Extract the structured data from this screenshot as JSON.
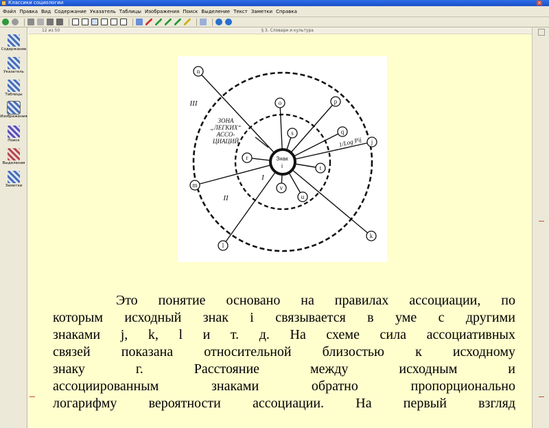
{
  "window": {
    "title": "Классики социологии"
  },
  "menu": [
    "Файл",
    "Правка",
    "Вид",
    "Содержание",
    "Указатель",
    "Таблицы",
    "Изображения",
    "Поиск",
    "Выделение",
    "Текст",
    "Заметки",
    "Справка"
  ],
  "sidebar": {
    "items": [
      {
        "label": "Содержание",
        "color": "#4a6fb5"
      },
      {
        "label": "Указатель",
        "color": "#4a6fb5"
      },
      {
        "label": "Таблицы",
        "color": "#4a6fb5"
      },
      {
        "label": "Изображения",
        "color": "#4a6fb5",
        "active": true
      },
      {
        "label": "Поиск",
        "color": "#5a4fb5"
      },
      {
        "label": "Выделения",
        "color": "#b54a4a"
      },
      {
        "label": "Заметки",
        "color": "#4a6fb5"
      }
    ]
  },
  "page": {
    "number": "12 из 50",
    "title": "§ 3. Словари и культура"
  },
  "figure": {
    "zone_label_lines": [
      "ЗОНА",
      "„ЛЕГКИХ“",
      "АССО-",
      "ЦИАЦИЙ"
    ],
    "center_line1": "Знак",
    "center_line2": "i",
    "roman_I": "I",
    "roman_II": "II",
    "roman_III": "III",
    "log_label": "1/Log Pij",
    "nodes": {
      "n": "n",
      "o": "o",
      "p": "p",
      "s": "s",
      "q": "q",
      "j": "j",
      "r": "r",
      "t": "t",
      "v": "v",
      "u": "u",
      "m": "m",
      "l": "l",
      "k": "k"
    }
  },
  "body_text": {
    "p1": "Это понятие основано на правилах ассоциации, по",
    "p2": "которым исходный знак i связывается в уме с другими",
    "p3": "знаками j, k, l и т. д. На схеме сила ассоциативных",
    "p4": "связей показана относительной близостью к исходному",
    "p5": "знаку г. Расстояние между исходным и",
    "p6": "ассоциированным знаками обратно пропорционально",
    "p7": "логарифму вероятности ассоциации. На первый взгляд"
  }
}
